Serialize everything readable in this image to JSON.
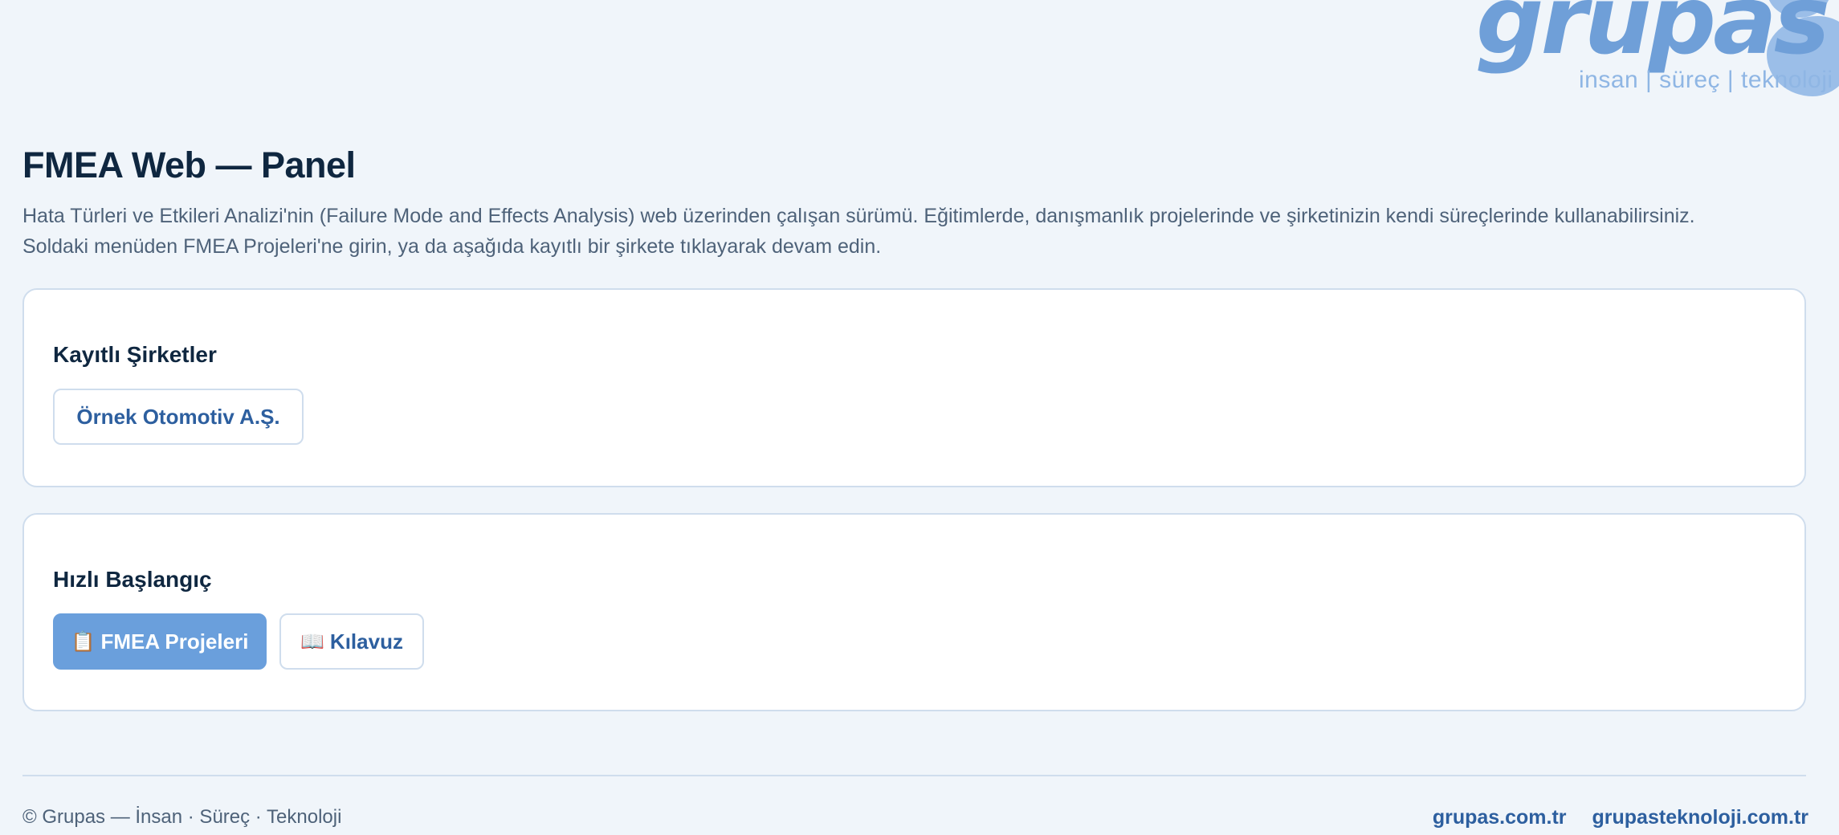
{
  "logo": {
    "wordmark": "grupas",
    "tagline": "insan | süreç | teknoloji"
  },
  "header": {
    "title": "FMEA Web — Panel",
    "description_line1": "Hata Türleri ve Etkileri Analizi'nin (Failure Mode and Effects Analysis) web üzerinden çalışan sürümü. Eğitimlerde, danışmanlık projelerinde ve şirketinizin kendi süreçlerinde kullanabilirsiniz.",
    "description_line2": "Soldaki menüden FMEA Projeleri'ne girin, ya da aşağıda kayıtlı bir şirkete tıklayarak devam edin."
  },
  "companies": {
    "heading": "Kayıtlı Şirketler",
    "items": [
      {
        "label": "Örnek Otomotiv A.Ş."
      }
    ]
  },
  "quick_start": {
    "heading": "Hızlı Başlangıç",
    "projects_button": {
      "icon": "📋",
      "icon_name": "clipboard-icon",
      "label": "FMEA Projeleri"
    },
    "guide_button": {
      "icon": "📖",
      "icon_name": "book-icon",
      "label": "Kılavuz"
    }
  },
  "footer": {
    "copyright": "© Grupas — İnsan · Süreç · Teknoloji",
    "links": [
      {
        "label": "grupas.com.tr"
      },
      {
        "label": "grupasteknoloji.com.tr"
      }
    ]
  },
  "colors": {
    "background": "#f0f5fa",
    "primary": "#6a9fdc",
    "link": "#2d5f9f",
    "heading": "#0f2740",
    "muted_text": "#4e6279",
    "border": "#cfdded"
  }
}
